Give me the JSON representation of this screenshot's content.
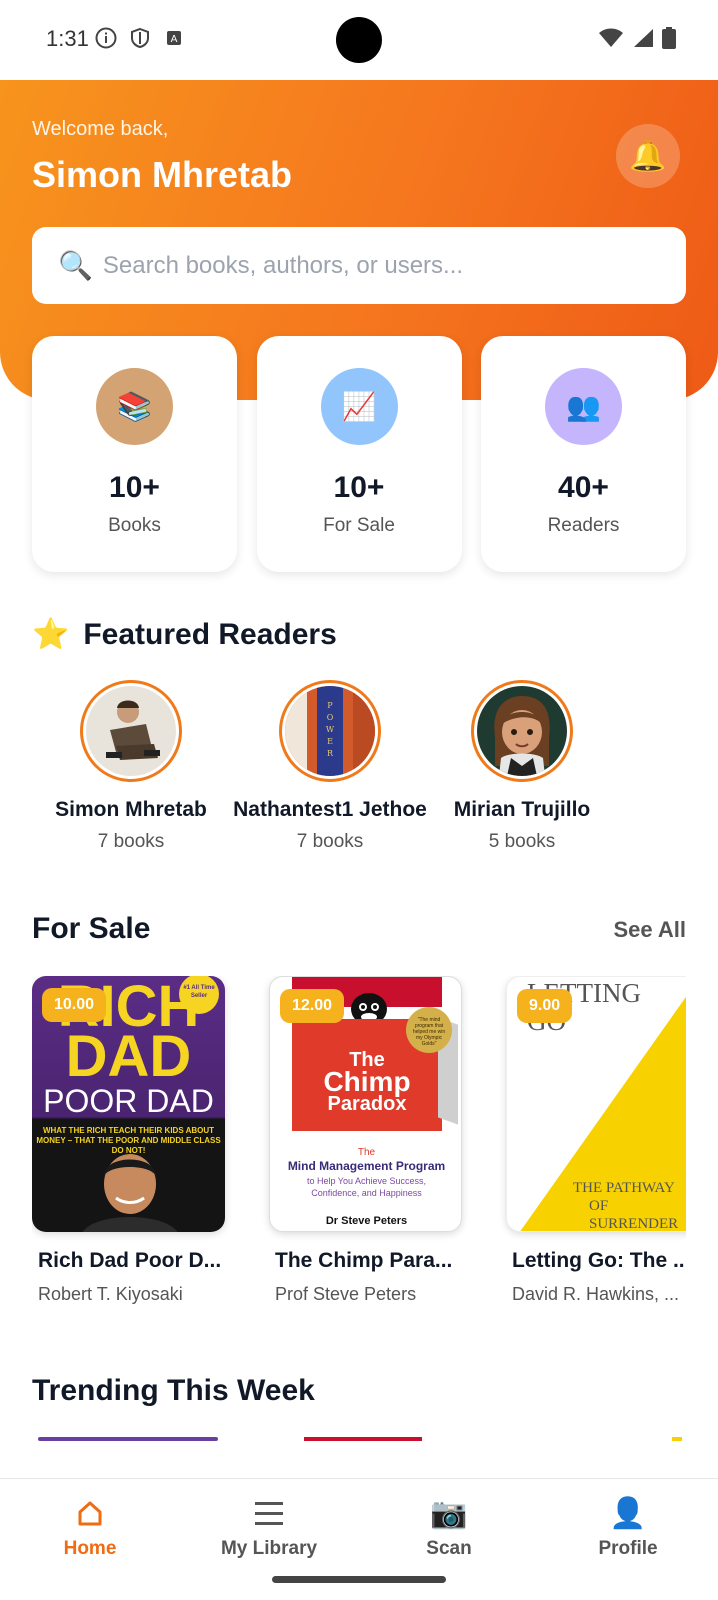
{
  "status_bar": {
    "time": "1:31"
  },
  "header": {
    "welcome": "Welcome back,",
    "user_name": "Simon Mhretab",
    "bell_icon": "bell-icon"
  },
  "search": {
    "placeholder": "Search books, authors, or users..."
  },
  "stats": [
    {
      "value": "10+",
      "label": "Books",
      "icon": "books-icon",
      "color": "#d4a373"
    },
    {
      "value": "10+",
      "label": "For Sale",
      "icon": "chart-icon",
      "color": "#93c5fd"
    },
    {
      "value": "40+",
      "label": "Readers",
      "icon": "users-icon",
      "color": "#c4b5fd"
    }
  ],
  "featured": {
    "title": "Featured Readers",
    "readers": [
      {
        "name": "Simon Mhretab",
        "count": "7 books"
      },
      {
        "name": "Nathantest1 Jethoe",
        "count": "7 books"
      },
      {
        "name": "Mirian Trujillo",
        "count": "5 books"
      }
    ]
  },
  "for_sale": {
    "title": "For Sale",
    "see_all": "See All",
    "books": [
      {
        "price": "10.00",
        "title": "Rich Dad Poor D...",
        "author": "Robert T. Kiyosaki",
        "cover": {
          "line1": "RICH",
          "line2": "DAD",
          "line3": "POOR DAD",
          "tagline": "WHAT THE RICH TEACH THEIR KIDS ABOUT MONEY – THAT THE POOR AND MIDDLE CLASS DO NOT!",
          "badge": "#1 All Time Seller"
        }
      },
      {
        "price": "12.00",
        "title": "The Chimp Para...",
        "author": "Prof Steve Peters",
        "cover": {
          "line1": "The",
          "line2": "Chimp",
          "line3": "Paradox",
          "sub1": "The",
          "sub2": "Mind Management Program",
          "sub3": "to Help You Achieve Success, Confidence, and Happiness",
          "author": "Dr Steve Peters",
          "badge": "\"The mind program that helped me win my Olympic Golds\""
        }
      },
      {
        "price": "9.00",
        "title": "Letting Go: The ...",
        "author": "David R. Hawkins, ...",
        "cover": {
          "line1": "LETTING",
          "line2": "GO",
          "sub1": "THE PATHWAY",
          "sub2": "OF SURRENDER"
        }
      }
    ]
  },
  "trending": {
    "title": "Trending This Week"
  },
  "nav": [
    {
      "label": "Home",
      "icon": "home-icon",
      "active": true
    },
    {
      "label": "My Library",
      "icon": "menu-icon",
      "active": false
    },
    {
      "label": "Scan",
      "icon": "camera-icon",
      "active": false
    },
    {
      "label": "Profile",
      "icon": "profile-icon",
      "active": false
    }
  ],
  "colors": {
    "accent": "#ef6c12",
    "price_badge": "#f5b21c"
  }
}
